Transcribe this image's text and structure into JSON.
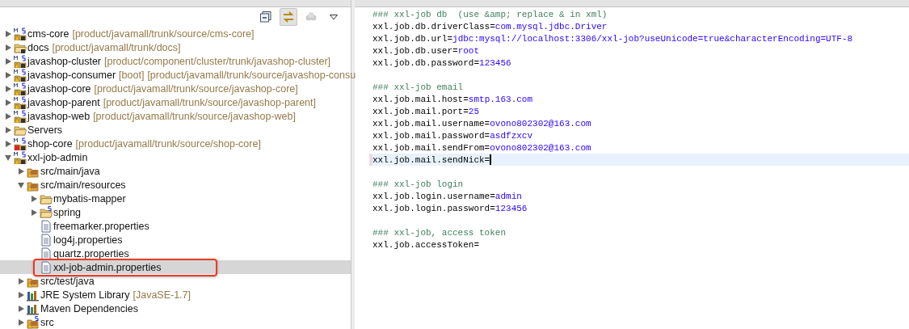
{
  "explorer": {
    "toolbar": [
      {
        "kind": "collapse",
        "pressed": false
      },
      {
        "kind": "link",
        "pressed": true
      },
      {
        "kind": "disabled",
        "pressed": false
      },
      {
        "kind": "menu",
        "pressed": false
      }
    ],
    "tree": [
      {
        "label": "cms-core",
        "decorations": [
          "[product/javamall/trunk/source/cms-core]"
        ],
        "kind": "project",
        "expanded": false,
        "selected": false
      },
      {
        "label": "docs",
        "decorations": [
          "[product/javamall/trunk/docs]"
        ],
        "kind": "folder-project",
        "expanded": false,
        "selected": false
      },
      {
        "label": "javashop-cluster",
        "decorations": [
          "[product/component/cluster/trunk/javashop-cluster]"
        ],
        "kind": "project",
        "expanded": false,
        "selected": false
      },
      {
        "label": "javashop-consumer",
        "decorations": [
          "[boot]",
          "[product/javamall/trunk/source/javashop-consu"
        ],
        "kind": "project",
        "expanded": false,
        "selected": false
      },
      {
        "label": "javashop-core",
        "decorations": [
          "[product/javamall/trunk/source/javashop-core]"
        ],
        "kind": "project",
        "expanded": false,
        "selected": false
      },
      {
        "label": "javashop-parent",
        "decorations": [
          "[product/javamall/trunk/source/javashop-parent]"
        ],
        "kind": "project",
        "expanded": false,
        "selected": false
      },
      {
        "label": "javashop-web",
        "decorations": [
          "[product/javamall/trunk/source/javashop-web]"
        ],
        "kind": "project",
        "expanded": false,
        "selected": false
      },
      {
        "label": "Servers",
        "kind": "folder",
        "expanded": false,
        "selected": false
      },
      {
        "label": "shop-core",
        "decorations": [
          "[product/javamall/trunk/source/shop-core]"
        ],
        "kind": "project-error",
        "expanded": false,
        "selected": false
      },
      {
        "label": "xxl-job-admin",
        "kind": "project",
        "expanded": true,
        "selected": false,
        "children": [
          {
            "label": "src/main/java",
            "kind": "source-folder",
            "expanded": false,
            "selected": false
          },
          {
            "label": "src/main/resources",
            "kind": "source-folder",
            "expanded": true,
            "selected": false,
            "children": [
              {
                "label": "mybatis-mapper",
                "kind": "folder",
                "expanded": false,
                "selected": false
              },
              {
                "label": "spring",
                "kind": "spring-folder",
                "expanded": false,
                "selected": false
              },
              {
                "label": "freemarker.properties",
                "kind": "file",
                "selected": false
              },
              {
                "label": "log4j.properties",
                "kind": "file",
                "selected": false
              },
              {
                "label": "quartz.properties",
                "kind": "file",
                "selected": false
              },
              {
                "label": "xxl-job-admin.properties",
                "kind": "file",
                "selected": true,
                "highlighted": true
              }
            ]
          },
          {
            "label": "src/test/java",
            "kind": "source-folder",
            "expanded": false,
            "selected": false
          },
          {
            "label": "JRE System Library",
            "decorations": [
              "[JavaSE-1.7]"
            ],
            "kind": "library",
            "expanded": false,
            "selected": false
          },
          {
            "label": "Maven Dependencies",
            "kind": "library",
            "expanded": false,
            "selected": false
          },
          {
            "label": "src",
            "kind": "spring-source",
            "expanded": false,
            "selected": false
          }
        ]
      }
    ]
  },
  "editor": {
    "lines": [
      {
        "kind": "comment",
        "text": "### xxl-job db  (use &amp; replace & in xml)",
        "current": false
      },
      {
        "kind": "property",
        "key": "xxl.job.db.driverClass=",
        "value": "com.mysql.jdbc.Driver",
        "current": false
      },
      {
        "kind": "property",
        "key": "xxl.job.db.url=",
        "value": "jdbc:mysql://localhost:3306/xxl-job?useUnicode=true&characterEncoding=UTF-8",
        "current": false
      },
      {
        "kind": "property",
        "key": "xxl.job.db.user=",
        "value": "root",
        "current": false
      },
      {
        "kind": "property",
        "key": "xxl.job.db.password=",
        "value": "123456",
        "current": false
      },
      {
        "kind": "blank",
        "current": false
      },
      {
        "kind": "comment",
        "text": "### xxl-job email",
        "current": false
      },
      {
        "kind": "property",
        "key": "xxl.job.mail.host=",
        "value": "smtp.163.com",
        "current": false
      },
      {
        "kind": "property",
        "key": "xxl.job.mail.port=",
        "value": "25",
        "current": false
      },
      {
        "kind": "property",
        "key": "xxl.job.mail.username=",
        "value": "ovono802302@163.com",
        "current": false
      },
      {
        "kind": "property",
        "key": "xxl.job.mail.password=",
        "value": "asdfzxcv",
        "current": false
      },
      {
        "kind": "property",
        "key": "xxl.job.mail.sendFrom=",
        "value": "ovono802302@163.com",
        "current": false
      },
      {
        "kind": "property",
        "key": "xxl.job.mail.sendNick=",
        "current": true
      },
      {
        "kind": "blank",
        "current": false
      },
      {
        "kind": "comment",
        "text": "### xxl-job login",
        "current": false
      },
      {
        "kind": "property",
        "key": "xxl.job.login.username=",
        "value": "admin",
        "current": false
      },
      {
        "kind": "property",
        "key": "xxl.job.login.password=",
        "value": "123456",
        "current": false
      },
      {
        "kind": "blank",
        "current": false
      },
      {
        "kind": "comment",
        "text": "### xxl-job, access token",
        "current": false
      },
      {
        "kind": "property",
        "key": "xxl.job.accessToken=",
        "current": false
      }
    ]
  }
}
